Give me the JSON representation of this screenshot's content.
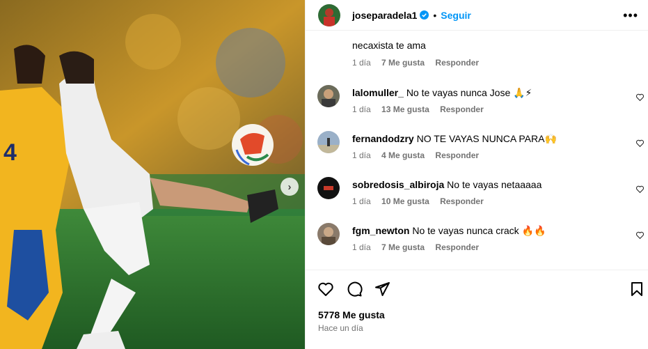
{
  "header": {
    "username": "joseparadela1",
    "separator": "•",
    "follow_label": "Seguir",
    "more_label": "•••"
  },
  "partial_comment": {
    "text": "necaxista te ama",
    "time": "1 día",
    "likes": "7 Me gusta",
    "reply": "Responder"
  },
  "comments": [
    {
      "user": "lalomuller_",
      "text": "No te vayas nunca Jose 🙏⚡",
      "time": "1 día",
      "likes": "13 Me gusta",
      "reply": "Responder"
    },
    {
      "user": "fernandodzry",
      "text": "NO TE VAYAS NUNCA PARA🙌",
      "time": "1 día",
      "likes": "4 Me gusta",
      "reply": "Responder"
    },
    {
      "user": "sobredosis_albiroja",
      "text": "No te vayas netaaaaa",
      "time": "1 día",
      "likes": "10 Me gusta",
      "reply": "Responder"
    },
    {
      "user": "fgm_newton",
      "text": "No te vayas nunca crack 🔥🔥",
      "time": "1 día",
      "likes": "7 Me gusta",
      "reply": "Responder"
    }
  ],
  "footer": {
    "likes_total": "5778 Me gusta",
    "time_ago": "Hace un día"
  },
  "photo": {
    "next_label": "›"
  },
  "colors": {
    "accent": "#0095f6",
    "muted": "#737373",
    "border": "#efefef"
  },
  "icons": [
    "heart-icon",
    "comment-icon",
    "share-icon",
    "bookmark-icon",
    "verified-icon",
    "chevron-right-icon"
  ]
}
